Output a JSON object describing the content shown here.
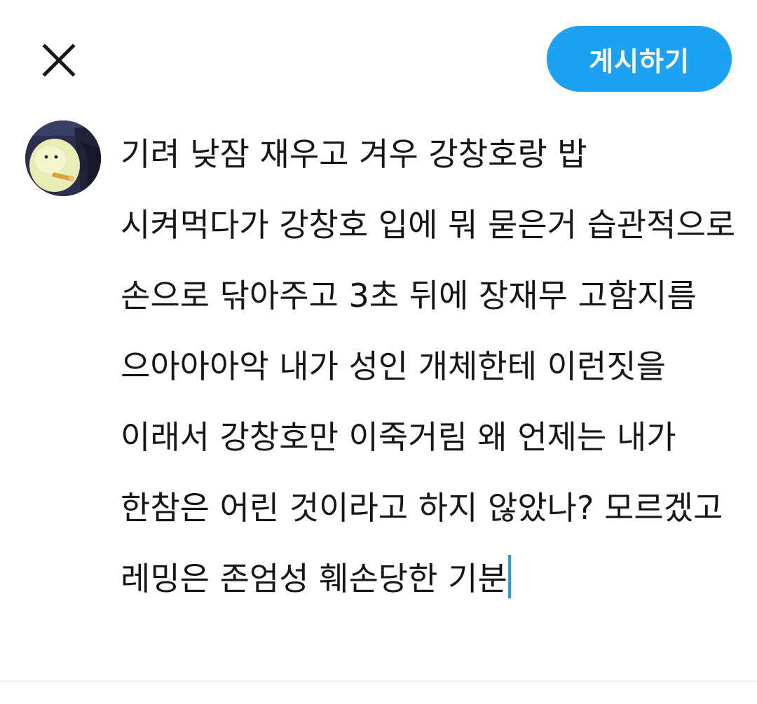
{
  "header": {
    "close_icon": "close-icon",
    "post_button_label": "게시하기",
    "post_button_color": "#1da1f2"
  },
  "compose": {
    "avatar_icon": "user-avatar-icon",
    "text": "기려 낮잠 재우고 겨우 강창호랑 밥 시켜먹다가 강창호 입에 뭐 묻은거 습관적으로 손으로 닦아주고 3초 뒤에 장재무 고함지름 으아아아악 내가 성인 개체한테 이런짓을 이래서 강창호만 이죽거림 왜 언제는 내가 한참은 어린 것이라고 하지 않았나? 모르겠고 레밍은 존엄성 훼손당한 기분",
    "caret_color": "#1da1f2"
  }
}
